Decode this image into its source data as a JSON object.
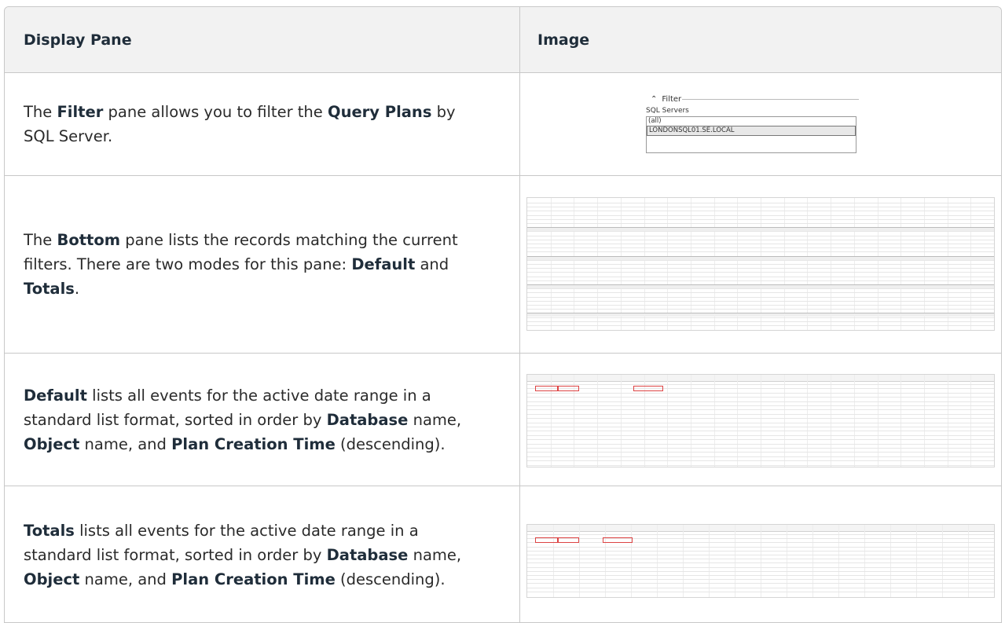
{
  "table": {
    "header": {
      "col1": "Display Pane",
      "col2": "Image"
    },
    "rows": [
      {
        "p1": "The ",
        "b1": "Filter",
        "p2": " pane allows you to filter the ",
        "b2": "Query Plans",
        "p3": " by SQL Server."
      },
      {
        "p1": "The ",
        "b1": "Bottom",
        "p2": " pane lists the records matching the current filters. There are two modes for this pane: ",
        "b2": "Default",
        "p3": " and ",
        "b3": "Totals",
        "p4": "."
      },
      {
        "b1": "Default",
        "p1": " lists all events for the active date range in a standard list format, sorted in order by ",
        "b2": "Database",
        "p2": " name, ",
        "b3": "Object",
        "p3": " name, and ",
        "b4": "Plan Creation Time",
        "p4": " (descending)."
      },
      {
        "b1": "Totals",
        "p1": " lists all events for the active date range in a standard list format, sorted in order by ",
        "b2": "Database",
        "p2": " name, ",
        "b3": "Object",
        "p3": " name, and ",
        "b4": "Plan Creation Time",
        "p4": " (descending)."
      }
    ]
  },
  "filter_image": {
    "title": "Filter",
    "label": "SQL Servers",
    "options": [
      "(all)",
      "LONDONSQL01.SE.LOCAL"
    ],
    "selected": "LONDONSQL01.SE.LOCAL"
  }
}
